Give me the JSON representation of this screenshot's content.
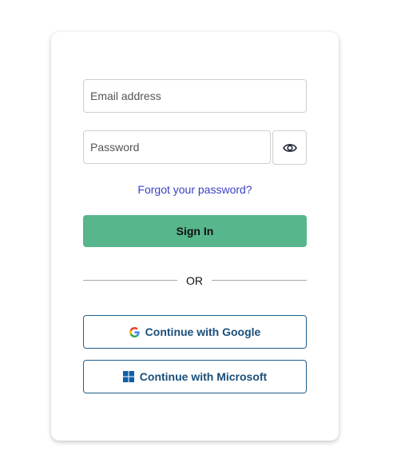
{
  "login": {
    "email": {
      "placeholder": "Email address",
      "value": ""
    },
    "password": {
      "placeholder": "Password",
      "value": ""
    },
    "show_password_icon": "eye-icon",
    "forgot_password_label": "Forgot your password?",
    "sign_in_label": "Sign In",
    "divider_label": "OR",
    "google": {
      "label": "Continue with Google",
      "icon": "google-logo-icon"
    },
    "microsoft": {
      "label": "Continue with Microsoft",
      "icon": "microsoft-logo-icon"
    }
  },
  "colors": {
    "primary_button": "#57b68c",
    "link": "#3b3fc7",
    "sso_border": "#1f5e8c",
    "sso_text": "#1a4f7a",
    "field_border": "#cfcfcf"
  }
}
